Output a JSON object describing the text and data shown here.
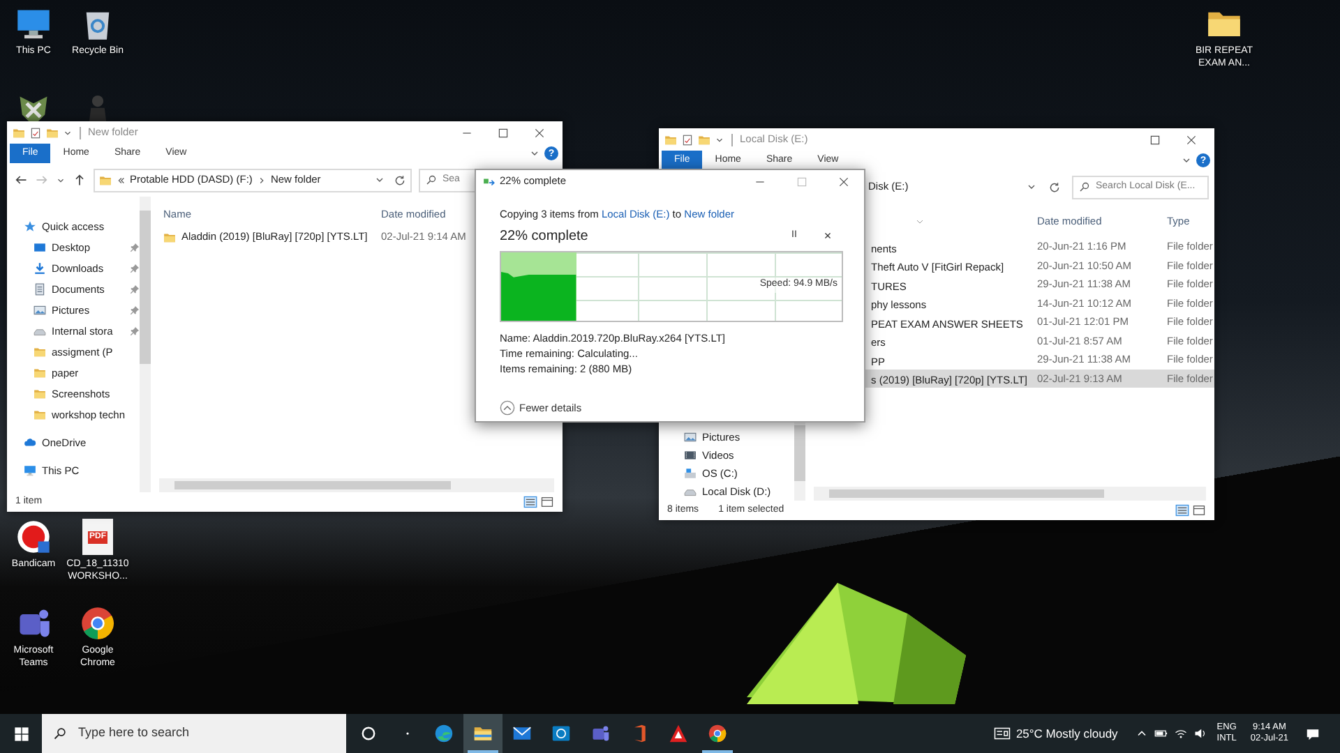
{
  "desktop_icons": [
    {
      "kind": "pc",
      "label": "This PC"
    },
    {
      "kind": "bin",
      "label": "Recycle Bin"
    },
    {
      "kind": "emblem"
    },
    {
      "kind": "figure"
    },
    {
      "kind": "bandicam",
      "label": "Bandicam"
    },
    {
      "kind": "pdf",
      "badge": "PDF",
      "label": "CD_18_11310 WORKSHO..."
    },
    {
      "kind": "teams",
      "label": "Microsoft Teams"
    },
    {
      "kind": "chrome",
      "label": "Google Chrome"
    },
    {
      "kind": "folder",
      "label": "BIR REPEAT EXAM AN..."
    }
  ],
  "left_window": {
    "title": "New folder",
    "ribbon_tabs": [
      {
        "label": "File",
        "selected": true
      },
      {
        "label": "Home",
        "selected": false
      },
      {
        "label": "Share",
        "selected": false
      },
      {
        "label": "View",
        "selected": false
      }
    ],
    "help": "?",
    "address": [
      "Protable HDD (DASD) (F:)",
      "New folder"
    ],
    "search": {
      "placeholder": "Sea"
    },
    "nav_items": [
      {
        "kind": "star",
        "label": "Quick access",
        "pinned": false
      },
      {
        "kind": "desktop",
        "label": "Desktop",
        "pinned": true
      },
      {
        "kind": "download",
        "label": "Downloads",
        "pinned": true
      },
      {
        "kind": "documents",
        "label": "Documents",
        "pinned": true
      },
      {
        "kind": "pictures",
        "label": "Pictures",
        "pinned": true
      },
      {
        "kind": "drive",
        "label": "Internal stora",
        "pinned": true
      },
      {
        "kind": "folder",
        "label": "assigment (P",
        "pinned": false
      },
      {
        "kind": "folder",
        "label": "paper",
        "pinned": false
      },
      {
        "kind": "folder",
        "label": "Screenshots",
        "pinned": false
      },
      {
        "kind": "folder",
        "label": "workshop techn",
        "pinned": false
      },
      {
        "kind": "cloud",
        "label": "OneDrive",
        "pinned": false
      },
      {
        "kind": "pc",
        "label": "This PC",
        "pinned": false
      }
    ],
    "columns": [
      "Name",
      "Date modified"
    ],
    "rows": [
      {
        "name": "Aladdin (2019) [BluRay] [720p] [YTS.LT]",
        "date": "02-Jul-21 9:14 AM",
        "selected": false
      }
    ],
    "status": [
      "1 item"
    ]
  },
  "right_window": {
    "title": "Local Disk (E:)",
    "ribbon_tabs": [
      {
        "label": "File",
        "selected": true
      },
      {
        "label": "Home",
        "selected": false
      },
      {
        "label": "Share",
        "selected": false
      },
      {
        "label": "View",
        "selected": false
      }
    ],
    "help": "?",
    "address": [
      "Disk (E:)"
    ],
    "search": {
      "placeholder": "Search Local Disk (E..."
    },
    "nav_items": [
      {
        "kind": "pictures",
        "label": "Pictures"
      },
      {
        "kind": "videos",
        "label": "Videos"
      },
      {
        "kind": "os",
        "label": "OS (C:)"
      },
      {
        "kind": "drive",
        "label": "Local Disk (D:)"
      }
    ],
    "columns": [
      "Date modified",
      "Type"
    ],
    "rows": [
      {
        "name": "nents",
        "date": "20-Jun-21 1:16 PM",
        "type": "File folder",
        "selected": false
      },
      {
        "name": "Theft Auto V [FitGirl Repack]",
        "date": "20-Jun-21 10:50 AM",
        "type": "File folder",
        "selected": false
      },
      {
        "name": "TURES",
        "date": "29-Jun-21 11:38 AM",
        "type": "File folder",
        "selected": false
      },
      {
        "name": "phy lessons",
        "date": "14-Jun-21 10:12 AM",
        "type": "File folder",
        "selected": false
      },
      {
        "name": "PEAT EXAM ANSWER SHEETS",
        "date": "01-Jul-21 12:01 PM",
        "type": "File folder",
        "selected": false
      },
      {
        "name": "ers",
        "date": "01-Jul-21 8:57 AM",
        "type": "File folder",
        "selected": false
      },
      {
        "name": "PP",
        "date": "29-Jun-21 11:38 AM",
        "type": "File folder",
        "selected": false
      },
      {
        "name": "s (2019) [BluRay] [720p] [YTS.LT]",
        "date": "02-Jul-21 9:13 AM",
        "type": "File folder",
        "selected": true
      }
    ],
    "status": [
      "8 items",
      "1 item selected"
    ]
  },
  "copy_dialog": {
    "title": "22% complete",
    "copying": {
      "prefix": "Copying 3 items from",
      "source": "Local Disk (E:)",
      "middle": "to",
      "destination": "New folder"
    },
    "heading": "22% complete",
    "pause": "II",
    "cancel": "×",
    "level": 0.22,
    "speed": "Speed: 94.9 MB/s",
    "details": [
      "Name: Aladdin.2019.720p.BluRay.x264 [YTS.LT]",
      "Time remaining: Calculating...",
      "Items remaining: 2 (880 MB)"
    ],
    "toggle": "Fewer details"
  },
  "taskbar": {
    "search": {
      "placeholder": "Type here to search"
    },
    "apps": [
      {
        "kind": "edge",
        "open": false,
        "active": false
      },
      {
        "kind": "explorer",
        "open": true,
        "active": true
      },
      {
        "kind": "mail",
        "open": false,
        "active": false
      },
      {
        "kind": "dell",
        "open": false,
        "active": false
      },
      {
        "kind": "teams",
        "open": false,
        "active": false
      },
      {
        "kind": "office",
        "open": false,
        "active": false
      },
      {
        "kind": "acrobat",
        "open": false,
        "active": false
      },
      {
        "kind": "chrome",
        "open": true,
        "active": false
      }
    ],
    "weather": "25°C Mostly cloudy",
    "language": [
      "ENG",
      "INTL"
    ],
    "time": "9:14 AM",
    "date": "02-Jul-21"
  }
}
